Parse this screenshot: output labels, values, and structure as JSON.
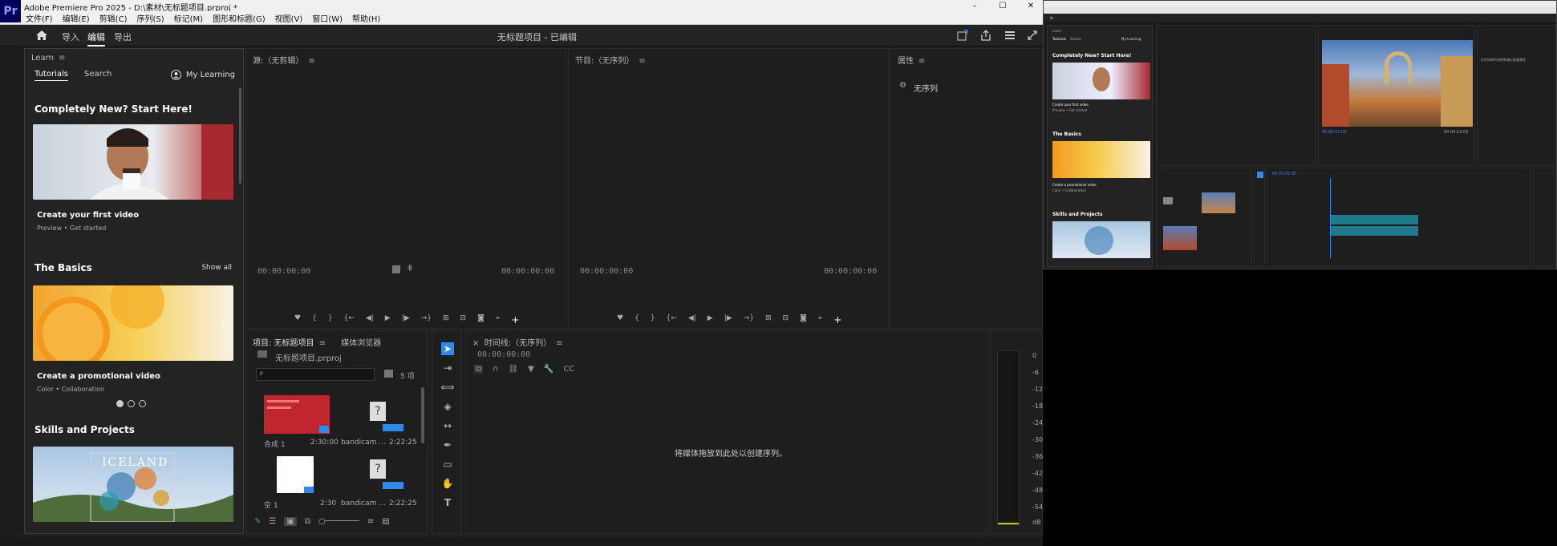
{
  "window": {
    "title": "Adobe Premiere Pro 2025 - D:\\素材\\无标题项目.prproj *",
    "app_logo": "Pr",
    "controls": [
      "–",
      "☐",
      "✕"
    ]
  },
  "menu": [
    "文件(F)",
    "编辑(E)",
    "剪辑(C)",
    "序列(S)",
    "标记(M)",
    "图形和标题(G)",
    "视图(V)",
    "窗口(W)",
    "帮助(H)"
  ],
  "workspace": {
    "tabs": [
      "导入",
      "编辑",
      "导出"
    ],
    "active": "编辑",
    "project_status": "无标题项目 - 已编辑"
  },
  "learn": {
    "title": "Learn",
    "tabs": [
      "Tutorials",
      "Search"
    ],
    "my_learning": "My Learning",
    "section1": "Completely New? Start Here!",
    "card1_title": "Create your first video",
    "card1_sub": "Preview  •  Get started",
    "section2": "The Basics",
    "show_all": "Show all",
    "card2_title": "Create a promotional video",
    "card2_sub": "Color  •  Collaboration",
    "section3": "Skills and Projects",
    "iceland": "ICELAND"
  },
  "source": {
    "title": "源:（无剪辑）",
    "tc_left": "00:00:00:00",
    "tc_right": "00:00:00:00"
  },
  "program": {
    "title": "节目:（无序列）",
    "tc_left": "00:00:00:00",
    "tc_right": "00:00:00:00"
  },
  "properties": {
    "title": "属性",
    "item": "无序列"
  },
  "project": {
    "tab1": "项目: 无标题项目",
    "tab2": "媒体浏览器",
    "path": "无标题项目.prproj",
    "count": "5 项",
    "items": [
      {
        "name": "合成 1",
        "duration": "2:30:00"
      },
      {
        "name": "bandicam ...",
        "duration": "2:22:25"
      },
      {
        "name": "空 1",
        "duration": "2:30"
      },
      {
        "name": "bandicam ...",
        "duration": "2:22:25"
      }
    ]
  },
  "timeline": {
    "title": "时间线:（无序列）",
    "timecode": "00:00:00:00",
    "empty_msg": "将媒体拖放到此处以创建序列。"
  },
  "meter": {
    "labels": [
      "0",
      "-6",
      "-12",
      "-18",
      "-24",
      "-30",
      "-36",
      "-42",
      "-48",
      "-54",
      "dB"
    ]
  },
  "mini": {
    "learn_title": "Learn",
    "tabs": [
      "Tutorials",
      "Search"
    ],
    "my_learning": "My Learning",
    "section1": "Completely New? Start Here!",
    "card1_title": "Create your first video",
    "card1_sub": "Preview  •  Get started",
    "section2": "The Basics",
    "card2_title": "Create a promotional video",
    "card2_sub": "Color  •  Collaboration",
    "section3": "Skills and Projects",
    "program_tc": "00:00:01:05",
    "program_dur": "00:00:13:02",
    "timeline_tc": "00:00:01:05",
    "props_text": "在时间线中选择剪辑以查看属性"
  },
  "colors": {
    "accent_blue": "#2d8ceb",
    "panel_bg": "#1e1e1e",
    "clip_teal": "#1f7a8c",
    "logo_bg": "#00005b"
  }
}
